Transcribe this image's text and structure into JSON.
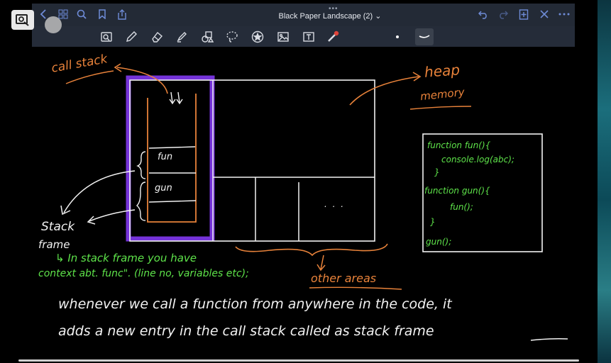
{
  "app": {
    "title": "Black Paper Landscape (2)",
    "title_chevron": "⌄",
    "more_dots": "•••"
  },
  "toolbar_icons": [
    "back-icon",
    "grid-icon",
    "search-icon",
    "bookmark-icon",
    "share-icon",
    "undo-icon",
    "redo-icon",
    "add-page-icon",
    "close-icon",
    "more-icon"
  ],
  "tools": [
    "zoom-text-tool",
    "pen-tool",
    "eraser-tool",
    "highlighter-tool",
    "shapes-tool",
    "lasso-tool",
    "star-tool",
    "image-tool",
    "textbox-tool",
    "laser-pointer-tool",
    "dot-color",
    "stroke-width"
  ],
  "notes": {
    "call_stack": "call stack",
    "heap_memory_1": "heap",
    "heap_memory_2": "memory",
    "frame_fun": "fun",
    "frame_gun": "gun",
    "ellipsis": ". . .",
    "stack_frame_1": "Stack",
    "stack_frame_2": "frame",
    "code_line1": "function fun(){",
    "code_line2": "console.log(abc);",
    "code_line3": "}",
    "code_line4": "function gun(){",
    "code_line5": "fun();",
    "code_line6": "}",
    "code_line7": "gun();",
    "note_line1": "↳ In stack frame you have",
    "note_line2": "context abt. func\". (line no, variables etc);",
    "other_areas": "other areas",
    "sentence_line1": "whenever we call a function from anywhere in the code, it",
    "sentence_line2": "adds a new entry in the call stack called as stack frame"
  },
  "colors": {
    "orange": "#e8823a",
    "white": "#f2f2f2",
    "green": "#5ee34a",
    "purple": "#8a3cff",
    "toolbar_blue": "#6e8bd6"
  }
}
